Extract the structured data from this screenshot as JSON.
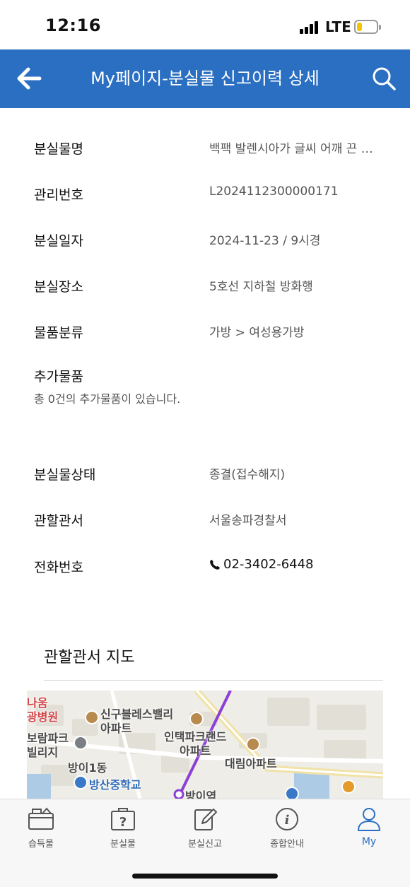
{
  "status_bar": {
    "time": "12:16",
    "network": "LTE",
    "battery_level": 0.25,
    "battery_color": "#f5c400"
  },
  "app_bar": {
    "title": "My페이지-분실물 신고이력 상세",
    "background": "#2a6fc1"
  },
  "details": {
    "item_name": {
      "label": "분실물명",
      "value": "백팩 발렌시아가 글씨 어깨 끈 빨간색"
    },
    "management_no": {
      "label": "관리번호",
      "value": "L2024112300000171"
    },
    "lost_date": {
      "label": "분실일자",
      "value": "2024-11-23 / 9시경"
    },
    "lost_place": {
      "label": "분실장소",
      "value": "5호선 지하철 방화행"
    },
    "category": {
      "label": "물품분류",
      "value": "가방 > 여성용가방"
    },
    "extra_items": {
      "label": "추가물품",
      "value": "총 0건의 추가물품이 있습니다."
    },
    "status": {
      "label": "분실물상태",
      "value": "종결(접수해지)"
    },
    "police_station": {
      "label": "관할관서",
      "value": "서울송파경찰서"
    },
    "phone": {
      "label": "전화번호",
      "value": "02-3402-6448"
    }
  },
  "map": {
    "title": "관할관서 지도",
    "labels": {
      "l1": "나움",
      "l2": "광병원",
      "l3": "신구블레스밸리",
      "l4": "아파트",
      "l5": "보람파크",
      "l6": "빌리지",
      "l7": "인택파크랜드",
      "l8": "아파트",
      "l9": "대림아파트",
      "l10": "방이1동",
      "l11": "방산중학교",
      "l12": "방이역"
    }
  },
  "tab_bar": {
    "items": [
      {
        "label": "습득물"
      },
      {
        "label": "분실물"
      },
      {
        "label": "분실신고"
      },
      {
        "label": "종합안내"
      },
      {
        "label": "My"
      }
    ],
    "active_color": "#2a6fc1"
  }
}
